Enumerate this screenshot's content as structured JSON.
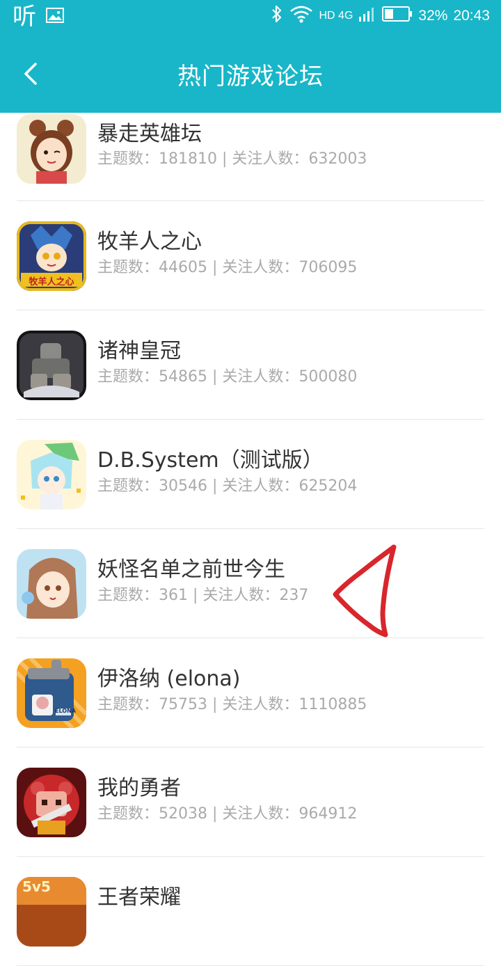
{
  "status_bar": {
    "left_glyph": "听",
    "network": "HD 4G",
    "battery": "32%",
    "time": "20:43",
    "icons": [
      "ting-app-icon",
      "gallery-icon",
      "bluetooth-icon",
      "wifi-icon",
      "signal-icon",
      "battery-icon"
    ]
  },
  "header": {
    "title": "热门游戏论坛",
    "background_color": "#18b6c8"
  },
  "forums": [
    {
      "name": "暴走英雄坛",
      "stats": "主题数：181810 | 关注人数：632003"
    },
    {
      "name": "牧羊人之心",
      "stats": "主题数：44605 | 关注人数：706095"
    },
    {
      "name": "诸神皇冠",
      "stats": "主题数：54865 | 关注人数：500080"
    },
    {
      "name": "D.B.System（测试版）",
      "stats": "主题数：30546 | 关注人数：625204"
    },
    {
      "name": "妖怪名单之前世今生",
      "stats": "主题数：361 | 关注人数：237"
    },
    {
      "name": "伊洛纳 (elona)",
      "stats": "主题数：75753 | 关注人数：1110885"
    },
    {
      "name": "我的勇者",
      "stats": "主题数：52038 | 关注人数：964912"
    },
    {
      "name": "王者荣耀",
      "stats": ""
    }
  ],
  "icon_labels": {
    "muyang": "牧羊人之心",
    "elona": "ELONA",
    "wangzhe": "5v5"
  },
  "annotation_color": "#d8262c"
}
